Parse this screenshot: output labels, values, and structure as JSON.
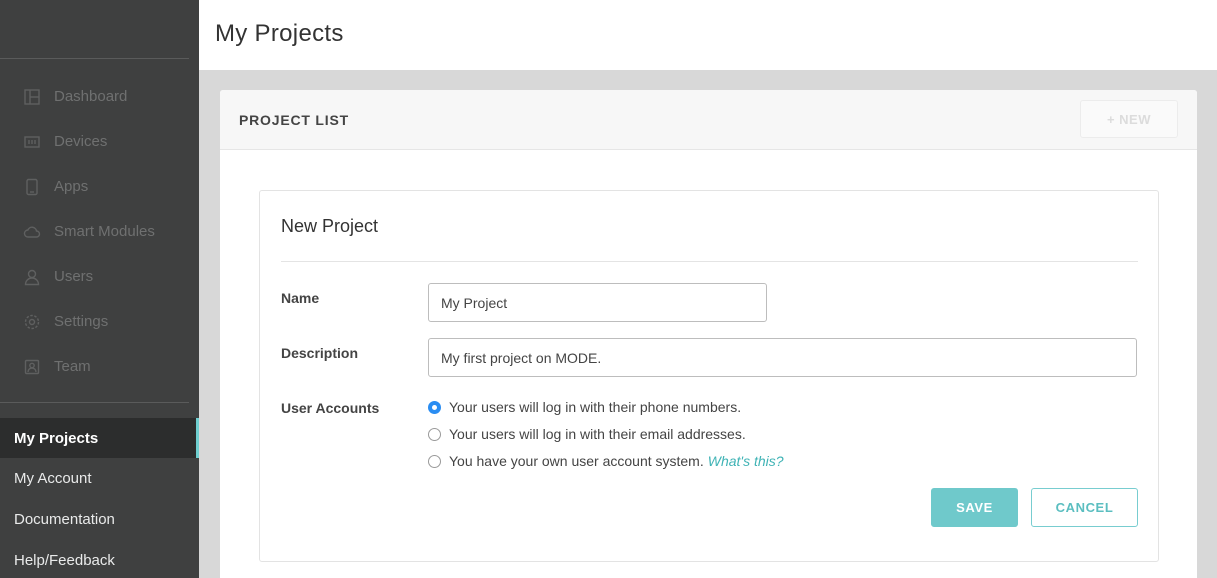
{
  "sidebar": {
    "nav": [
      {
        "label": "Dashboard",
        "icon": "dashboard-icon"
      },
      {
        "label": "Devices",
        "icon": "devices-icon"
      },
      {
        "label": "Apps",
        "icon": "apps-icon"
      },
      {
        "label": "Smart Modules",
        "icon": "cloud-icon"
      },
      {
        "label": "Users",
        "icon": "user-icon"
      },
      {
        "label": "Settings",
        "icon": "gear-icon"
      },
      {
        "label": "Team",
        "icon": "team-icon"
      }
    ],
    "account": [
      {
        "label": "My Projects",
        "active": true
      },
      {
        "label": "My Account",
        "active": false
      },
      {
        "label": "Documentation",
        "active": false
      },
      {
        "label": "Help/Feedback",
        "active": false
      }
    ]
  },
  "header": {
    "title": "My Projects"
  },
  "panel": {
    "title": "PROJECT LIST",
    "new_button": "+ NEW"
  },
  "form": {
    "title": "New Project",
    "name_label": "Name",
    "name_value": "My Project",
    "description_label": "Description",
    "description_value": "My first project on MODE.",
    "user_accounts_label": "User Accounts",
    "options": [
      {
        "label": "Your users will log in with their phone numbers.",
        "checked": true
      },
      {
        "label": "Your users will log in with their email addresses.",
        "checked": false
      },
      {
        "label": "You have your own user account system.",
        "checked": false,
        "link": "What's this?"
      }
    ],
    "save_label": "SAVE",
    "cancel_label": "CANCEL"
  },
  "colors": {
    "sidebar_bg": "#3f4040",
    "accent": "#6fc9cb",
    "radio_checked": "#2a8df2",
    "link": "#3fb3b5"
  }
}
